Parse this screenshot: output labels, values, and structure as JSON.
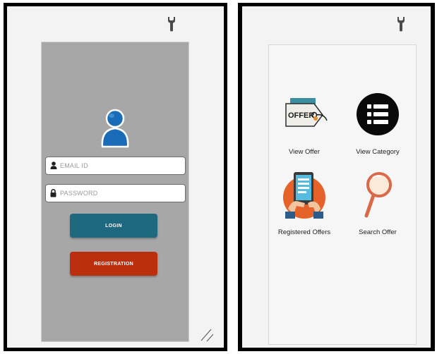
{
  "login_screen": {
    "email": {
      "placeholder": "EMAIL ID",
      "value": ""
    },
    "password": {
      "placeholder": "PASSWORD",
      "value": ""
    },
    "login_label": "LOGIN",
    "registration_label": "REGISTRATION"
  },
  "home_screen": {
    "tiles": [
      {
        "label": "View Offer",
        "icon": "offer-tag-icon"
      },
      {
        "label": "View Category",
        "icon": "list-icon"
      },
      {
        "label": "Registered Offers",
        "icon": "tablet-hand-icon"
      },
      {
        "label": "Search Offer",
        "icon": "magnifier-icon"
      }
    ]
  },
  "icons": {
    "top_right": "wrench-icon",
    "user": "user-avatar-icon",
    "email_field": "person-icon",
    "password_field": "lock-icon"
  },
  "colors": {
    "login_button": "#1e6880",
    "registration_button": "#bb2e0e",
    "login_panel_bg": "#a7a7a7",
    "avatar": "#1a6bb8"
  }
}
